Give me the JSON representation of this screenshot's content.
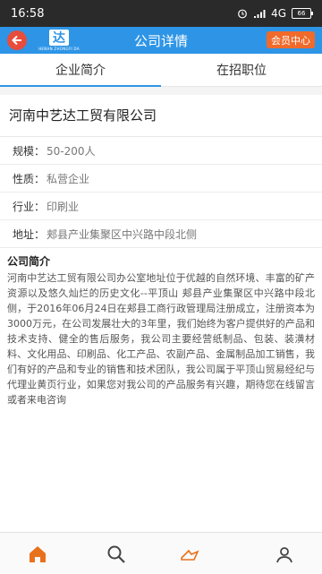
{
  "status": {
    "time": "16:58",
    "network": "4G",
    "battery": "66"
  },
  "header": {
    "title": "公司详情",
    "member_button": "会员中心",
    "logo_mark": "达",
    "logo_sub": "HENAN ZHONGYI DA"
  },
  "tabs": [
    {
      "label": "企业简介"
    },
    {
      "label": "在招职位"
    }
  ],
  "company": {
    "name": "河南中艺达工贸有限公司",
    "fields": [
      {
        "key": "规模：",
        "value": "50-200人"
      },
      {
        "key": "性质：",
        "value": "私营企业"
      },
      {
        "key": "行业：",
        "value": "印刷业"
      },
      {
        "key": "地址：",
        "value": "郏县产业集聚区中兴路中段北侧"
      }
    ],
    "intro_title": "公司简介",
    "intro_text": "河南中艺达工贸有限公司办公室地址位于优越的自然环境、丰富的矿产资源以及悠久灿烂的历史文化--平顶山 郏县产业集聚区中兴路中段北侧，于2016年06月24日在郏县工商行政管理局注册成立，注册资本为3000万元，在公司发展壮大的3年里，我们始终为客户提供好的产品和技术支持、健全的售后服务，我公司主要经营纸制品、包装、装潢材料、文化用品、印刷品、化工产品、农副产品、金属制品加工销售，我们有好的产品和专业的销售和技术团队，我公司属于平顶山贸易经纪与代理业黄页行业，如果您对我公司的产品服务有兴趣，期待您在线留言或者来电咨询"
  },
  "colors": {
    "primary": "#2e95e6",
    "accent": "#f06a2b",
    "home_icon": "#e8711c"
  },
  "nav": [
    {
      "icon": "home-icon"
    },
    {
      "icon": "search-icon"
    },
    {
      "icon": "message-icon"
    },
    {
      "icon": "profile-icon"
    }
  ]
}
